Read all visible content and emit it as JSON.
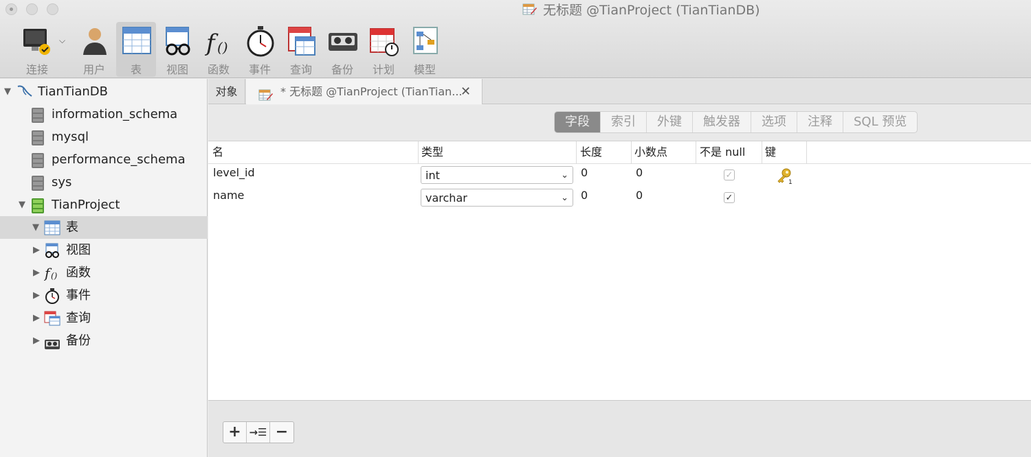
{
  "window": {
    "title": "无标题 @TianProject (TianTianDB)"
  },
  "toolbar": {
    "items": [
      {
        "label": "连接",
        "icon": "connection-icon"
      },
      {
        "label": "用户",
        "icon": "user-icon"
      },
      {
        "label": "表",
        "icon": "table-icon",
        "active": true
      },
      {
        "label": "视图",
        "icon": "view-icon"
      },
      {
        "label": "函数",
        "icon": "function-icon"
      },
      {
        "label": "事件",
        "icon": "event-icon"
      },
      {
        "label": "查询",
        "icon": "query-icon"
      },
      {
        "label": "备份",
        "icon": "backup-icon"
      },
      {
        "label": "计划",
        "icon": "schedule-icon"
      },
      {
        "label": "模型",
        "icon": "model-icon"
      }
    ]
  },
  "sidebar": {
    "connection": "TianTianDB",
    "databases": [
      "information_schema",
      "mysql",
      "performance_schema",
      "sys"
    ],
    "open_database": "TianProject",
    "children": [
      {
        "label": "表",
        "icon": "table-icon",
        "expanded": true,
        "selected": true
      },
      {
        "label": "视图",
        "icon": "view-icon"
      },
      {
        "label": "函数",
        "icon": "function-icon"
      },
      {
        "label": "事件",
        "icon": "event-icon"
      },
      {
        "label": "查询",
        "icon": "query-icon"
      },
      {
        "label": "备份",
        "icon": "backup-icon"
      }
    ]
  },
  "tabs": {
    "objects": "对象",
    "design": "* 无标题 @TianProject (TianTian..."
  },
  "segments": [
    {
      "label": "字段",
      "active": true
    },
    {
      "label": "索引"
    },
    {
      "label": "外键"
    },
    {
      "label": "触发器"
    },
    {
      "label": "选项"
    },
    {
      "label": "注释"
    },
    {
      "label": "SQL 预览"
    }
  ],
  "grid": {
    "headers": {
      "name": "名",
      "type": "类型",
      "length": "长度",
      "decimals": "小数点",
      "not_null": "不是 null",
      "key": "键"
    },
    "rows": [
      {
        "name": "level_id",
        "type": "int",
        "length": "0",
        "decimals": "0",
        "not_null": true,
        "not_null_disabled": true,
        "key": true
      },
      {
        "name": "name",
        "type": "varchar",
        "length": "0",
        "decimals": "0",
        "not_null": true,
        "not_null_disabled": false,
        "key": false
      }
    ]
  },
  "bottom": {
    "add_label": "+",
    "insert_label": "→☰",
    "remove_label": "−"
  },
  "colors": {
    "active_segment": "#8a8a8a",
    "key_gold": "#e1b32e"
  }
}
